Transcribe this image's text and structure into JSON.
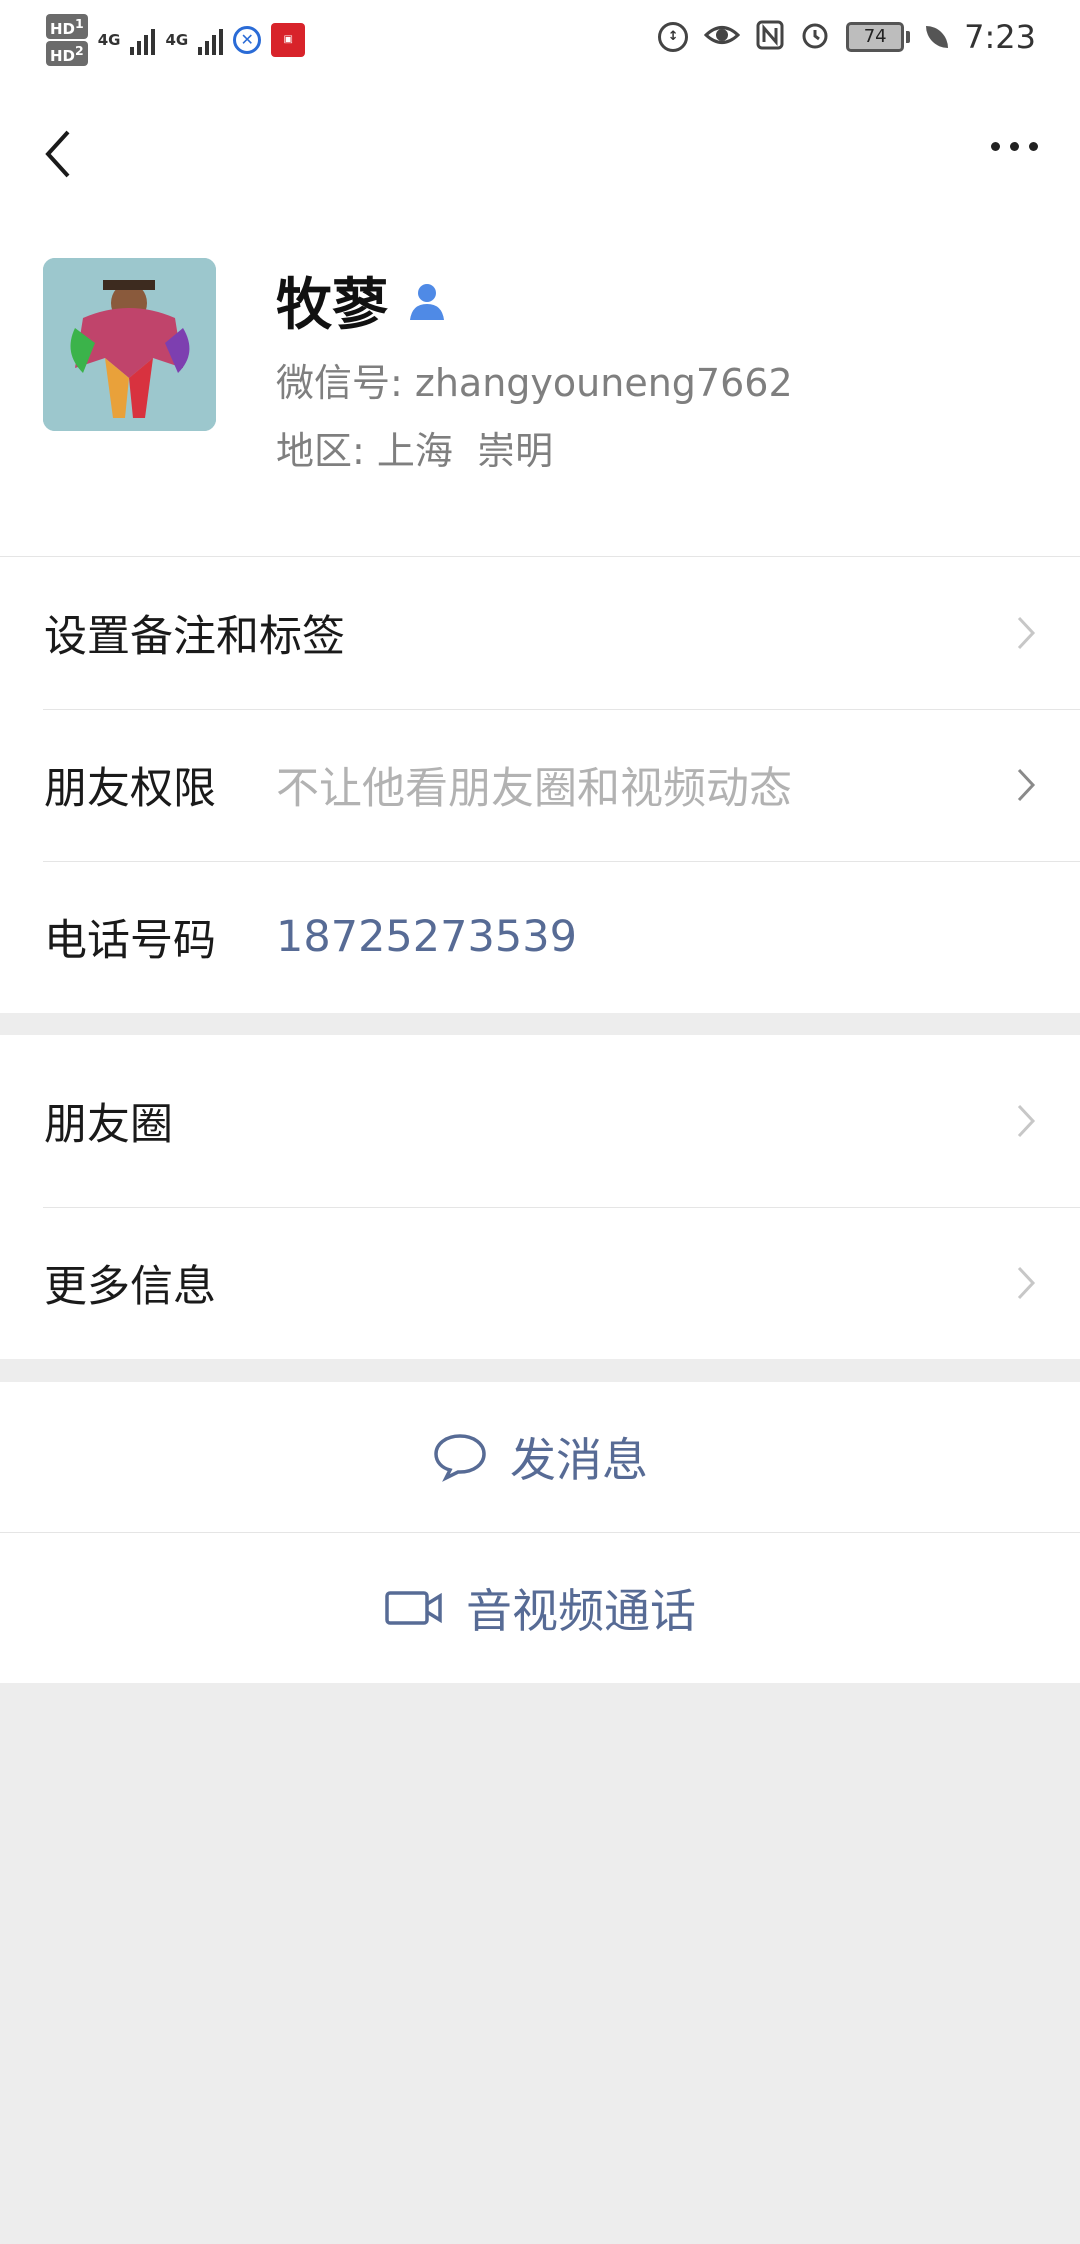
{
  "status_bar": {
    "sim1": "HD",
    "sim1_index": "1",
    "sim2": "HD",
    "sim2_index": "2",
    "network1": "4G",
    "network2": "4G",
    "battery": "74",
    "time": "7:23",
    "icons": [
      "signal-icon",
      "app-icon-blue",
      "app-icon-red",
      "data-saver-icon",
      "eye-comfort-icon",
      "nfc-icon",
      "alarm-icon",
      "battery-icon",
      "leaf-icon"
    ]
  },
  "nav": {
    "back_icon": "chevron-left-icon",
    "more_icon": "more-dots-icon"
  },
  "profile": {
    "name": "牧蓼",
    "wxid_label": "微信号:",
    "wxid_value": "zhangyouneng7662",
    "region_label": "地区:",
    "region_value": "上海  崇明"
  },
  "group1": {
    "remark_label": "设置备注和标签",
    "permission_label": "朋友权限",
    "permission_value": "不让他看朋友圈和视频动态",
    "phone_label": "电话号码",
    "phone_value": "18725273539"
  },
  "group2": {
    "moments_label": "朋友圈",
    "more_info_label": "更多信息"
  },
  "actions": {
    "message_label": "发消息",
    "call_label": "音视频通话"
  },
  "colors": {
    "link": "#576b95",
    "background": "#ededed",
    "badge": "#4f8ae6"
  }
}
